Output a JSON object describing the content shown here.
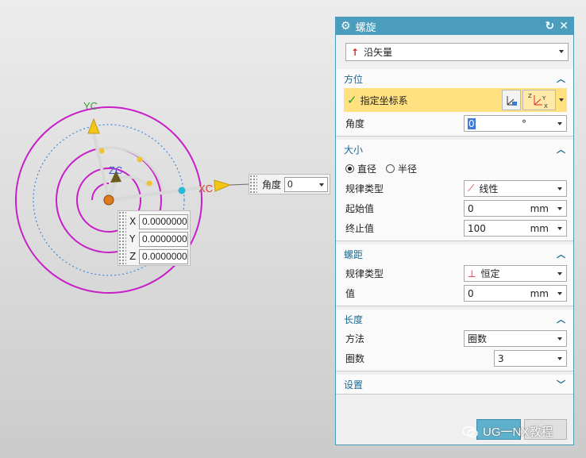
{
  "viewport": {
    "axis_labels": {
      "yc": "YC",
      "zc": "ZC",
      "xc": "XC"
    },
    "coords": [
      {
        "label": "X",
        "value": "0.0000000"
      },
      {
        "label": "Y",
        "value": "0.0000000"
      },
      {
        "label": "Z",
        "value": "0.0000000"
      }
    ],
    "angle_label": "角度",
    "angle_value": "0",
    "colors": {
      "spiral": "#c71fc7",
      "dotted_circle": "#3a8ae0",
      "origin": "#e07a1f"
    }
  },
  "dialog": {
    "title": "螺旋",
    "vector_dropdown": "沿矢量",
    "orientation": {
      "title": "方位",
      "specify_csys": "指定坐标系",
      "angle_label": "角度",
      "angle_value": "0",
      "angle_unit": "°"
    },
    "size": {
      "title": "大小",
      "radio_diameter": "直径",
      "radio_radius": "半径",
      "law_type_label": "规律类型",
      "law_type_value": "线性",
      "start_label": "起始值",
      "start_value": "0",
      "start_unit": "mm",
      "end_label": "终止值",
      "end_value": "100",
      "end_unit": "mm"
    },
    "pitch": {
      "title": "螺距",
      "law_type_label": "规律类型",
      "law_type_value": "恒定",
      "value_label": "值",
      "value": "0",
      "unit": "mm"
    },
    "length": {
      "title": "长度",
      "method_label": "方法",
      "method_value": "圈数",
      "turns_label": "圈数",
      "turns_value": "3"
    },
    "settings": {
      "title": "设置"
    },
    "colors": {
      "titlebar": "#4a9dbd",
      "section_title": "#1b6a93",
      "highlight": "#ffe180"
    }
  },
  "watermark": "UG一NX教程"
}
